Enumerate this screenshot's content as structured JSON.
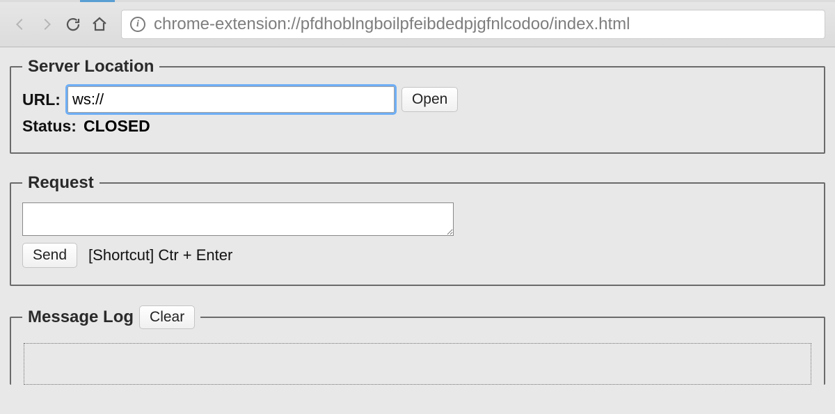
{
  "browser": {
    "url": "chrome-extension://pfdhoblngboilpfeibdedpjgfnlcodoo/index.html"
  },
  "server_location": {
    "legend": "Server Location",
    "url_label": "URL:",
    "url_value": "ws://",
    "open_label": "Open",
    "status_label": "Status:",
    "status_value": "CLOSED"
  },
  "request": {
    "legend": "Request",
    "body": "",
    "send_label": "Send",
    "shortcut_hint": "[Shortcut] Ctr + Enter"
  },
  "message_log": {
    "legend": "Message Log",
    "clear_label": "Clear"
  }
}
